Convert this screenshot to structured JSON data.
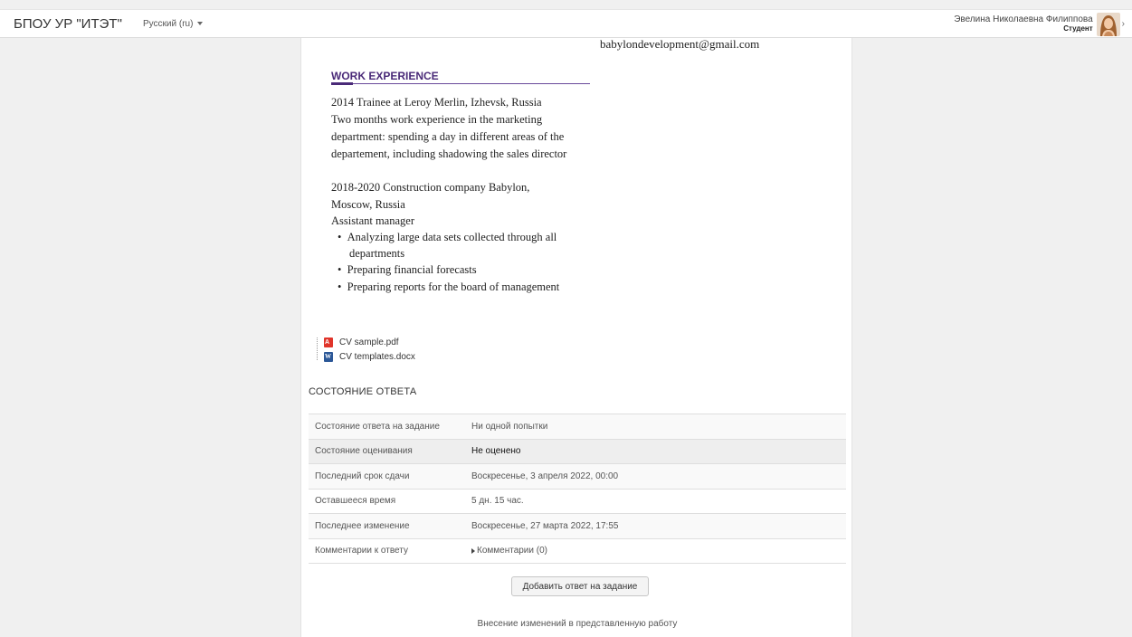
{
  "navbar": {
    "brand": "БПОУ УР \"ИТЭТ\"",
    "language": "Русский (ru)",
    "user_name": "Эвелина Николаевна Филиппова",
    "user_role": "Студент"
  },
  "document": {
    "email": "babylondevelopment@gmail.com",
    "section_heading": "WORK EXPERIENCE",
    "lines": [
      "2014 Trainee at Leroy Merlin, Izhevsk, Russia",
      "Two months work experience in the marketing",
      "department: spending a day in different areas of the",
      "departement, including shadowing the sales director",
      "2018-2020  Construction company Babylon,",
      "Moscow, Russia",
      "Assistant manager"
    ],
    "bullets": [
      "Analyzing large data sets collected through all",
      "departments",
      "Preparing financial forecasts",
      "Preparing reports for the board of management"
    ]
  },
  "files": [
    {
      "name": "CV sample.pdf",
      "icon": "pdf-file-icon"
    },
    {
      "name": "CV templates.docx",
      "icon": "word-file-icon"
    }
  ],
  "submission_status": {
    "title": "СОСТОЯНИЕ ОТВЕТА",
    "rows": [
      {
        "label": "Состояние ответа на задание",
        "value": "Ни одной попытки"
      },
      {
        "label": "Состояние оценивания",
        "value": "Не оценено"
      },
      {
        "label": "Последний срок сдачи",
        "value": "Воскресенье, 3 апреля 2022, 00:00"
      },
      {
        "label": "Оставшееся время",
        "value": "5 дн. 15 час."
      },
      {
        "label": "Последнее изменение",
        "value": "Воскресенье, 27 марта 2022, 17:55"
      },
      {
        "label": "Комментарии к ответу",
        "value": "Комментарии (0)"
      }
    ],
    "add_button": "Добавить ответ на задание",
    "note": "Внесение изменений в представленную работу"
  },
  "colors": {
    "section_heading": "#4a2a78",
    "highlight_row": "#eeeeee",
    "pdf_icon": "#e0342a",
    "word_icon": "#2b5797"
  }
}
